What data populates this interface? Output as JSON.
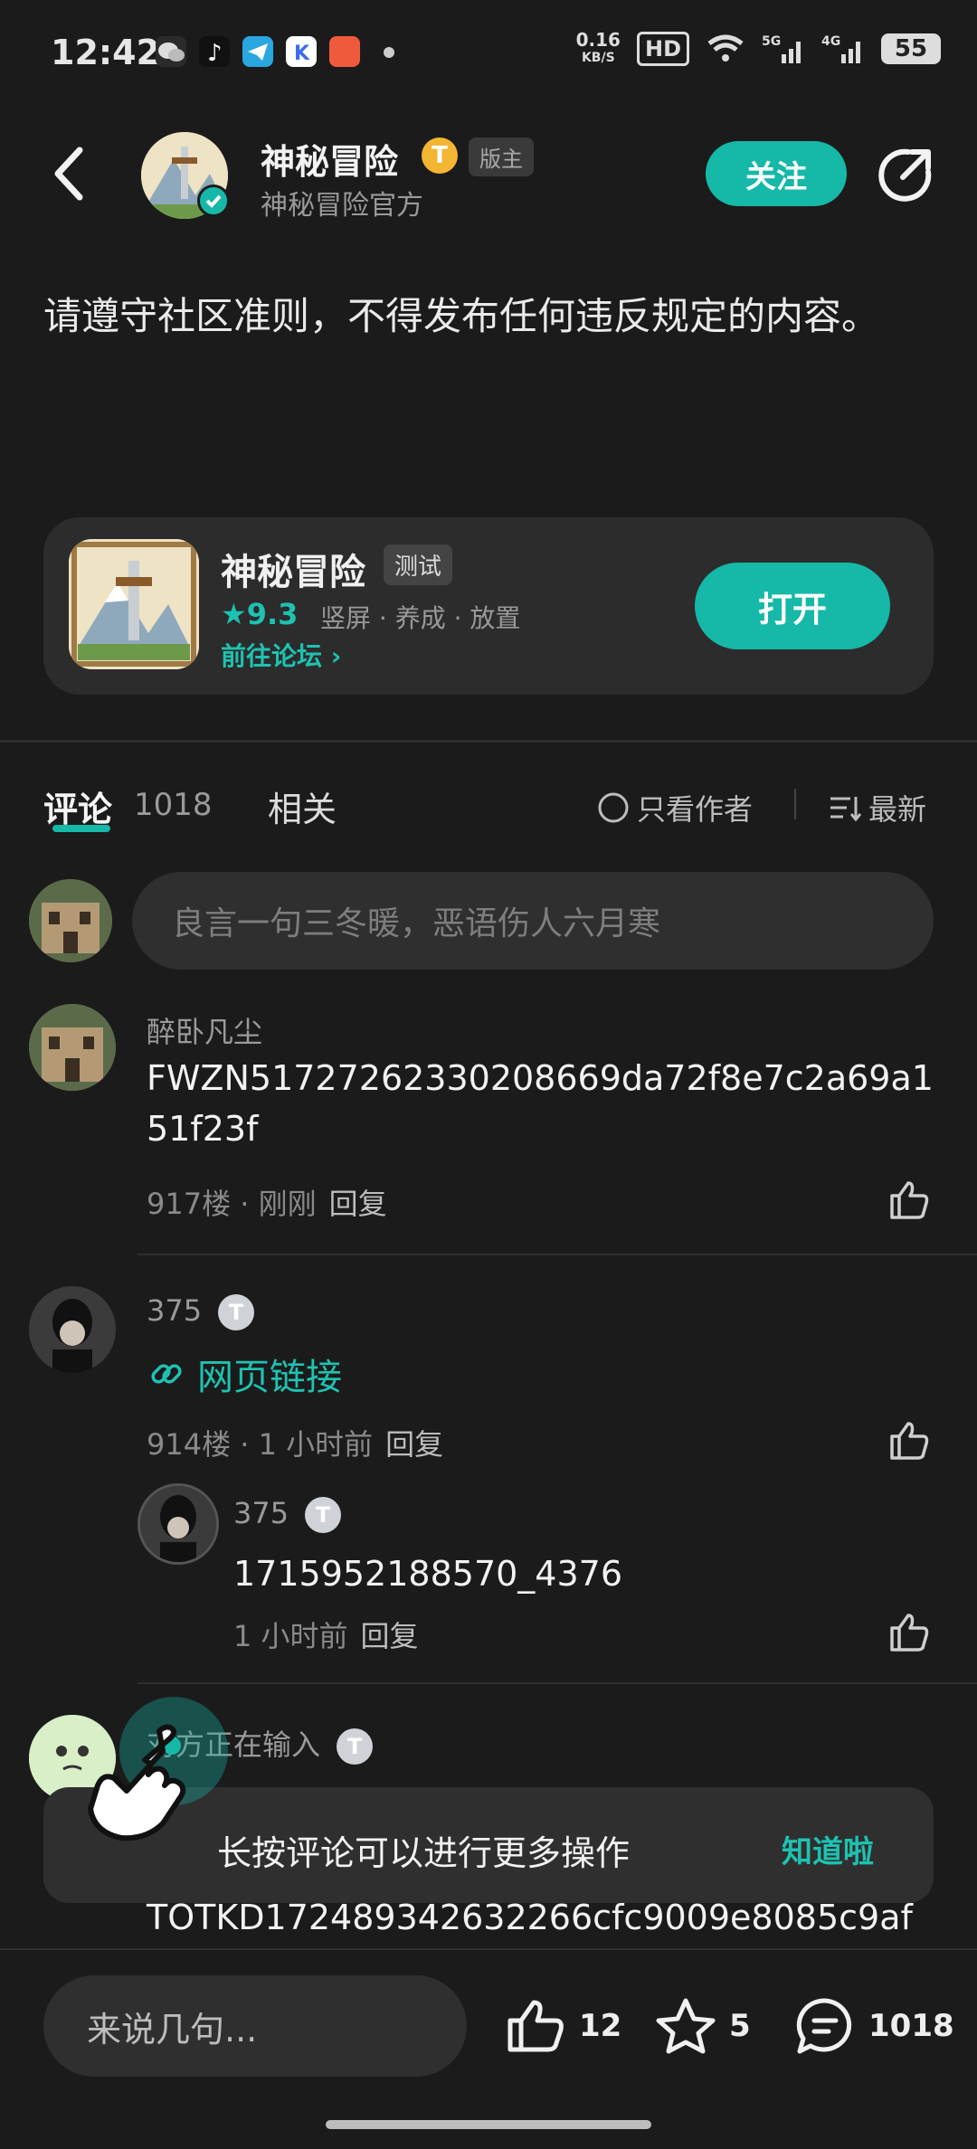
{
  "status": {
    "time": "12:42",
    "speed": "0.16",
    "speed_unit": "KB/S",
    "hd": "HD",
    "battery": "55"
  },
  "header": {
    "title": "神秘冒险",
    "subtitle": "神秘冒险官方",
    "badge": "T",
    "mod_tag": "版主",
    "follow_label": "关注"
  },
  "post": {
    "text": "请遵守社区准则，不得发布任何违反规定的内容。"
  },
  "app_card": {
    "name": "神秘冒险",
    "test_tag": "测试",
    "rating": "★9.3",
    "tags": "竖屏 · 养成 · 放置",
    "forum_link": "前往论坛 ›",
    "open_label": "打开"
  },
  "tabs": {
    "comments": "评论",
    "comments_count": "1018",
    "related": "相关",
    "only_author": "只看作者",
    "sort": "最新"
  },
  "comment_input": {
    "placeholder": "良言一句三冬暖，恶语伤人六月寒"
  },
  "comments": [
    {
      "user": "醉卧凡尘",
      "text": "FWZN51727262330208669da72f8e7c2a69a151f23f",
      "meta": "917楼 · 刚刚",
      "reply": "回复"
    },
    {
      "user": "375",
      "level": "T",
      "link_text": "网页链接",
      "meta": "914楼 · 1 小时前",
      "reply": "回复",
      "sub": {
        "user": "375",
        "level": "T",
        "text": "1715952188570_4376",
        "meta": "1 小时前",
        "reply": "回复"
      }
    },
    {
      "user": "对方正在输入",
      "level": "T",
      "text_partial": "TOTKD172489342632266cfc9009e8085c9af"
    }
  ],
  "toast": {
    "text": "长按评论可以进行更多操作",
    "button": "知道啦"
  },
  "bottom": {
    "input_placeholder": "来说几句...",
    "likes": "12",
    "stars": "5",
    "comments": "1018"
  },
  "colors": {
    "accent": "#16b8a8",
    "background": "#1b1b1b"
  }
}
